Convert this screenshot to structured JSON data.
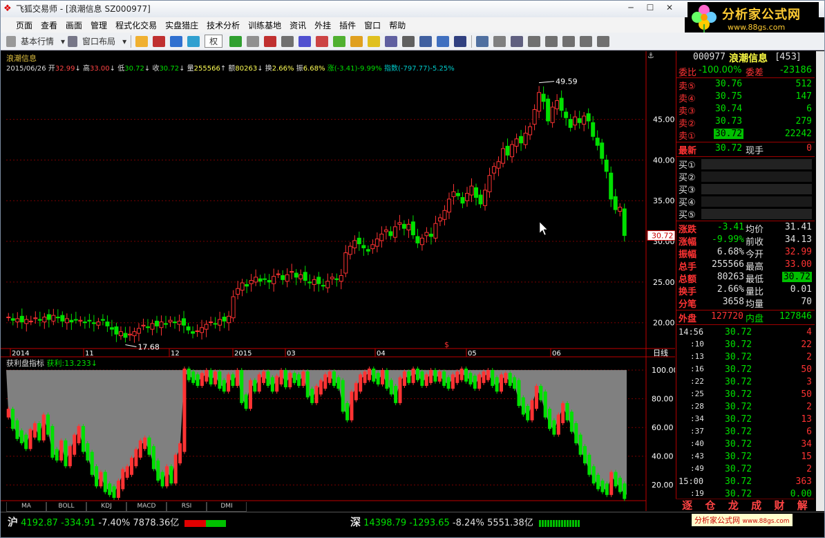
{
  "window": {
    "title": "飞狐交易师 - [浪潮信息 SZ000977]"
  },
  "brand": {
    "name": "分析家公式网",
    "url": "www.88gs.com"
  },
  "menu": [
    "页面",
    "查看",
    "画面",
    "管理",
    "程式化交易",
    "实盘猎庄",
    "技术分析",
    "训练基地",
    "资讯",
    "外挂",
    "插件",
    "窗口",
    "帮助"
  ],
  "toolbar": {
    "basic": "基本行情",
    "layout": "窗口布局",
    "quan": "权"
  },
  "stock_name": "浪潮信息",
  "header": {
    "date": "2015/06/26",
    "open_label": "开",
    "open": "32.99",
    "high_label": "高",
    "high": "33.00",
    "low_label": "低",
    "low": "30.72",
    "close_label": "收",
    "close": "30.72",
    "vol_label": "量",
    "vol": "255566",
    "amt_label": "额",
    "amt": "80263",
    "turn_label": "换",
    "turn": "2.66%",
    "amp_label": "振",
    "amp": "6.68%",
    "chg_label": "涨",
    "chg": "(-3.41)-9.99%",
    "idx_label": "指数",
    "idx": "(-797.77)-5.25%"
  },
  "chart_data": [
    {
      "type": "candlestick",
      "title": "浪潮信息",
      "period": "日线",
      "ylim": [
        17,
        51
      ],
      "yticks": [
        "20.00",
        "25.00",
        "30.00",
        "35.00",
        "40.00",
        "45.00"
      ],
      "xticks": [
        "2014",
        "11",
        "12",
        "2015",
        "03",
        "04",
        "05",
        "06"
      ],
      "max_label": "49.59",
      "min_label": "17.68",
      "last_price": "30.72",
      "closes": [
        20.7,
        20.3,
        20.5,
        20.1,
        20.4,
        20.2,
        20.6,
        20.3,
        20.7,
        20.4,
        20.9,
        20.6,
        20.2,
        20.5,
        20.1,
        20.4,
        20.3,
        20.0,
        20.2,
        19.9,
        20.1,
        20.3,
        19.6,
        19.2,
        18.6,
        18.9,
        18.2,
        18.6,
        18.9,
        19.3,
        19.7,
        19.4,
        19.9,
        19.6,
        20.1,
        19.8,
        20.3,
        20.0,
        20.2,
        19.7,
        19.1,
        18.7,
        19.0,
        19.4,
        19.8,
        20.1,
        19.9,
        20.4,
        20.2,
        20.8,
        23.2,
        24.2,
        24.9,
        24.5,
        25.2,
        25.6,
        25.1,
        25.4,
        25.0,
        25.7,
        26.0,
        25.3,
        25.9,
        26.3,
        25.6,
        25.9,
        25.2,
        24.9,
        25.3,
        24.8,
        24.5,
        25.1,
        25.6,
        25.3,
        25.8,
        28.6,
        29.4,
        30.1,
        29.7,
        29.2,
        28.8,
        29.6,
        30.3,
        30.9,
        31.4,
        30.7,
        31.8,
        32.3,
        31.6,
        32.1,
        30.8,
        29.8,
        30.4,
        31.1,
        30.6,
        32.2,
        32.9,
        33.8,
        35.2,
        36.1,
        35.6,
        34.7,
        35.9,
        36.8,
        35.4,
        34.6,
        36.3,
        38.1,
        39.2,
        39.8,
        41.4,
        40.6,
        41.9,
        42.6,
        42.1,
        43.3,
        44.1,
        46.2,
        48.3,
        47.2,
        44.8,
        46.5,
        47.3,
        46.1,
        45.2,
        44.0,
        45.3,
        44.6,
        45.4,
        44.8,
        42.9,
        41.8,
        40.2,
        38.6,
        35.2,
        33.9,
        34.2,
        30.72
      ],
      "x_range": "2014 – 2015/06/26"
    },
    {
      "type": "bar",
      "title": "获利盘指标",
      "value_label": "获利:",
      "value": "13.233",
      "ylim": [
        10,
        102
      ],
      "yticks": [
        "20.00",
        "40.00",
        "60.00",
        "80.00",
        "100.00"
      ],
      "values": [
        70,
        62,
        55,
        52,
        48,
        56,
        60,
        54,
        66,
        58,
        42,
        40,
        48,
        36,
        44,
        52,
        58,
        46,
        40,
        30,
        22,
        26,
        18,
        16,
        14,
        20,
        28,
        30,
        36,
        42,
        48,
        50,
        44,
        34,
        26,
        22,
        30,
        24,
        38,
        46,
        98,
        96,
        94,
        92,
        95,
        97,
        93,
        96,
        90,
        88,
        94,
        92,
        97,
        80,
        76,
        90,
        88,
        94,
        96,
        92,
        88,
        93,
        97,
        91,
        95,
        94,
        92,
        96,
        84,
        80,
        86,
        90,
        94,
        96,
        92,
        90,
        74,
        68,
        82,
        88,
        94,
        96,
        98,
        95,
        93,
        97,
        90,
        86,
        80,
        92,
        96,
        94,
        98,
        96,
        92,
        94,
        97,
        95,
        96,
        92,
        90,
        94,
        96,
        98,
        95,
        93,
        90,
        94,
        96,
        97,
        92,
        88,
        94,
        95,
        92,
        90,
        78,
        72,
        68,
        76,
        86,
        82,
        70,
        62,
        58,
        66,
        74,
        68,
        60,
        52,
        44,
        38,
        30,
        24,
        20,
        18,
        16,
        26,
        22,
        18,
        13.233
      ]
    }
  ],
  "bottom_tabs": [
    "MA",
    "BOLL",
    "KDJ",
    "MACD",
    "RSI",
    "DMI"
  ],
  "quote": {
    "code": "000977",
    "name": "浪潮信息",
    "count": "[453]",
    "weibi_label": "委比",
    "weibi": "-100.00%",
    "weicha_label": "委差",
    "weicha": "-23186",
    "asks": [
      {
        "label": "卖⑤",
        "price": "30.76",
        "vol": "512"
      },
      {
        "label": "卖④",
        "price": "30.75",
        "vol": "147"
      },
      {
        "label": "卖③",
        "price": "30.74",
        "vol": "6"
      },
      {
        "label": "卖②",
        "price": "30.73",
        "vol": "279"
      },
      {
        "label": "卖①",
        "price": "30.72",
        "vol": "22242"
      }
    ],
    "latest_label": "最新",
    "latest": "30.72",
    "xianshou_label": "现手",
    "xianshou": "0",
    "bids": [
      "买①",
      "买②",
      "买③",
      "买④",
      "买⑤"
    ],
    "stats": [
      {
        "l1": "涨跌",
        "v1": "-3.41",
        "l2": "均价",
        "v2": "31.41"
      },
      {
        "l1": "涨幅",
        "v1": "-9.99%",
        "l2": "前收",
        "v2": "34.13"
      },
      {
        "l1": "振幅",
        "v1": "6.68%",
        "l2": "今开",
        "v2": "32.99"
      },
      {
        "l1": "总手",
        "v1": "255566",
        "l2": "最高",
        "v2": "33.00"
      },
      {
        "l1": "总额",
        "v1": "80263",
        "l2": "最低",
        "v2": "30.72"
      },
      {
        "l1": "换手",
        "v1": "2.66%",
        "l2": "量比",
        "v2": "0.01"
      },
      {
        "l1": "分笔",
        "v1": "3658",
        "l2": "均量",
        "v2": "70"
      }
    ],
    "waipan_label": "外盘",
    "waipan": "127720",
    "neipan_label": "内盘",
    "neipan": "127846",
    "ticks": [
      {
        "t": "14:56",
        "p": "30.72",
        "v": "4"
      },
      {
        "t": ":10",
        "p": "30.72",
        "v": "22"
      },
      {
        "t": ":13",
        "p": "30.72",
        "v": "2"
      },
      {
        "t": ":16",
        "p": "30.72",
        "v": "50"
      },
      {
        "t": ":22",
        "p": "30.72",
        "v": "3"
      },
      {
        "t": ":25",
        "p": "30.72",
        "v": "50"
      },
      {
        "t": ":28",
        "p": "30.72",
        "v": "2"
      },
      {
        "t": ":34",
        "p": "30.72",
        "v": "13"
      },
      {
        "t": ":37",
        "p": "30.72",
        "v": "6"
      },
      {
        "t": ":40",
        "p": "30.72",
        "v": "34"
      },
      {
        "t": ":43",
        "p": "30.72",
        "v": "15"
      },
      {
        "t": ":49",
        "p": "30.72",
        "v": "2"
      },
      {
        "t": "15:00",
        "p": "30.72",
        "v": "363"
      },
      {
        "t": ":19",
        "p": "30.72",
        "v": "0.00"
      }
    ],
    "right_tabs": [
      "逐",
      "仓",
      "龙",
      "成",
      "财",
      "解"
    ]
  },
  "status": {
    "sh_label": "沪",
    "sh_idx": "4192.87",
    "sh_chg": "-334.91",
    "sh_pct": "-7.40%",
    "sh_amt": "7878.36亿",
    "sz_label": "深",
    "sz_idx": "14398.79",
    "sz_chg": "-1293.65",
    "sz_pct": "-8.24%",
    "sz_amt": "5551.38亿",
    "watermark": "分析家公式网",
    "watermark_url": "www.88gs.com"
  },
  "colors": {
    "up": "#ff3333",
    "down": "#00e000",
    "grid": "#a00000",
    "label": "#ffffff"
  }
}
